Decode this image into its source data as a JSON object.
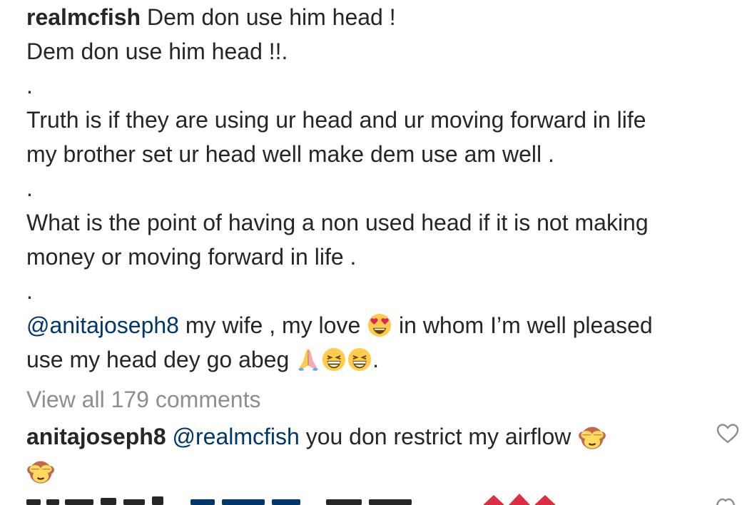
{
  "post": {
    "username": "realmcfish",
    "line1": " Dem don use him head !",
    "line2": "Dem don use him head !!.",
    "dot1": ".",
    "line3": "Truth is if they are using ur head and ur moving forward in life",
    "line4": "my brother set ur head well make dem use am well .",
    "dot2": ".",
    "line5": "What is the point of having a non used head if it is not making",
    "line6": "money or moving forward in life .",
    "dot3": ".",
    "mention": "@anitajoseph8",
    "line7_a": " my wife , my love ",
    "line7_b": " in whom I’m well pleased",
    "line8": "use my head dey go abeg ",
    "line8_end": "."
  },
  "view_all_comments": "View all 179 comments",
  "comment": {
    "username": "anitajoseph8",
    "mention": "@realmcfish",
    "text": " you don restrict my airflow "
  },
  "icons": {
    "heart_eyes": "heart-eyes-emoji",
    "pray": "folded-hands-emoji",
    "grin": "grinning-squinting-emoji",
    "see_no_evil": "see-no-evil-monkey-emoji",
    "like": "heart-outline-icon"
  },
  "colors": {
    "text": "#262626",
    "mention": "#00376b",
    "muted": "#8e8e8e"
  }
}
